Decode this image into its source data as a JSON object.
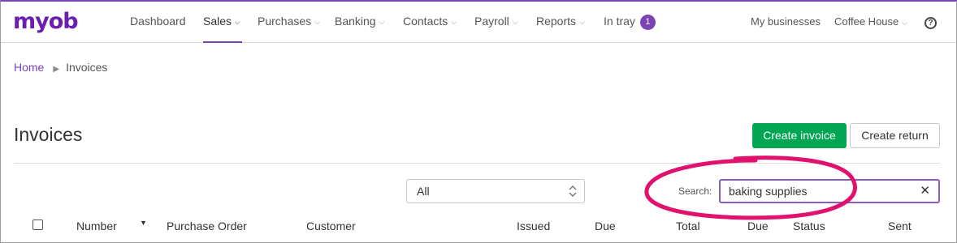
{
  "brand": {
    "logo_text": "myob",
    "accent_color": "#7a43b6",
    "primary_button_color": "#00a651"
  },
  "nav": {
    "items": [
      {
        "label": "Dashboard",
        "has_dropdown": false,
        "active": false
      },
      {
        "label": "Sales",
        "has_dropdown": true,
        "active": true
      },
      {
        "label": "Purchases",
        "has_dropdown": true,
        "active": false
      },
      {
        "label": "Banking",
        "has_dropdown": true,
        "active": false
      },
      {
        "label": "Contacts",
        "has_dropdown": true,
        "active": false
      },
      {
        "label": "Payroll",
        "has_dropdown": true,
        "active": false
      },
      {
        "label": "Reports",
        "has_dropdown": true,
        "active": false
      },
      {
        "label": "In tray",
        "has_dropdown": false,
        "active": false,
        "badge": "1"
      }
    ],
    "my_businesses": "My businesses",
    "business_name": "Coffee House",
    "help_icon": "question-circle-icon"
  },
  "breadcrumb": {
    "home": "Home",
    "current": "Invoices"
  },
  "page": {
    "title": "Invoices",
    "create_invoice_label": "Create invoice",
    "create_return_label": "Create return"
  },
  "filters": {
    "status_select_value": "All",
    "search_label": "Search:",
    "search_value": "baking supplies",
    "clear_icon": "close-icon"
  },
  "table": {
    "columns": [
      "Number",
      "Purchase Order",
      "Customer",
      "Issued",
      "Due",
      "Total",
      "Due",
      "Status",
      "Sent"
    ],
    "sorted_column": "Number"
  }
}
